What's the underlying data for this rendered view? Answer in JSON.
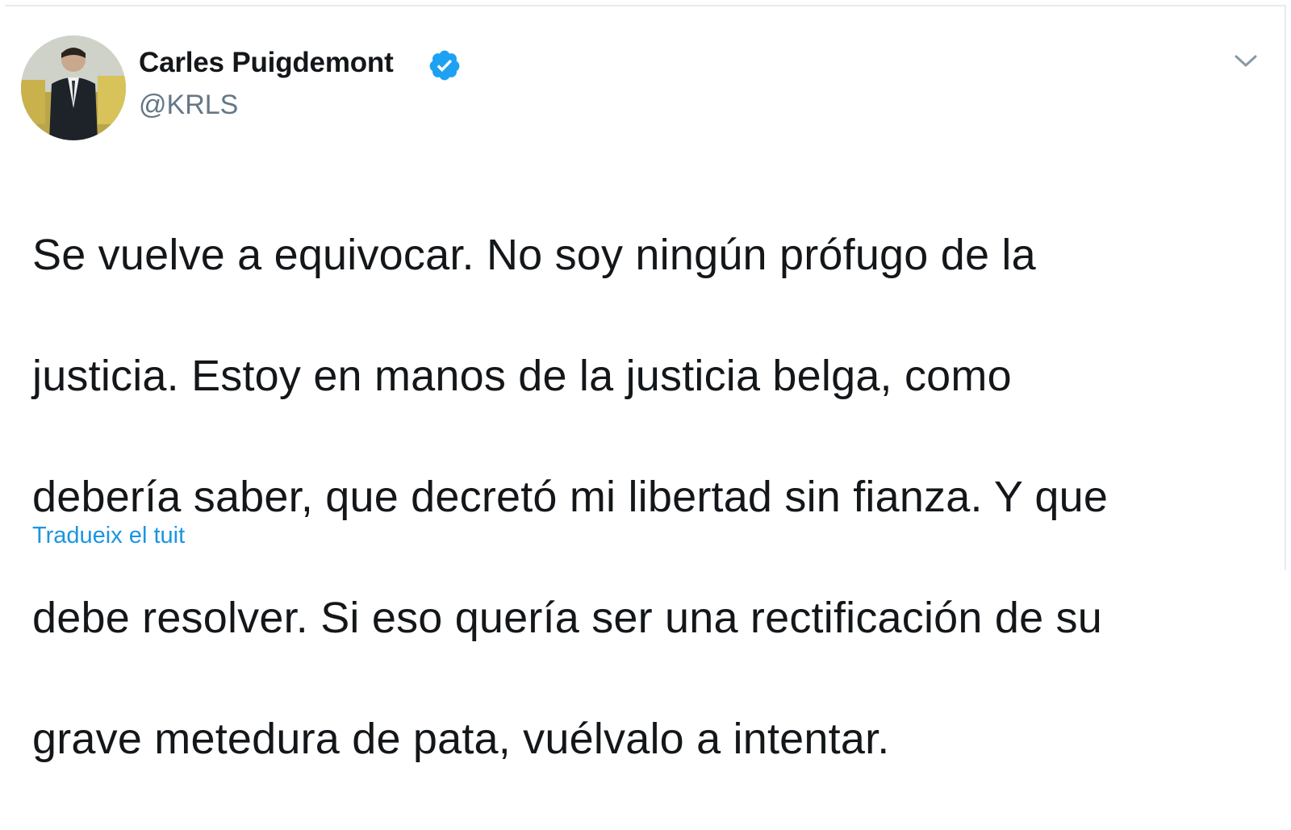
{
  "tweet": {
    "author_name": "Carles Puigdemont",
    "author_handle": "@KRLS",
    "text_lines": [
      "Se vuelve a equivocar. No soy ningún prófugo de la",
      "justicia. Estoy en manos de la justicia belga, como",
      "debería saber, que decretó mi libertad sin fianza. Y que",
      "debe resolver. Si eso quería ser una rectificación de su",
      "grave metedura de pata, vuélvalo a intentar."
    ],
    "translate_label": "Tradueix el tuit"
  },
  "icons": {
    "avatar": "avatar-photo",
    "verified": "verified-badge-icon",
    "menu": "chevron-down-icon"
  },
  "colors": {
    "name": "#14171a",
    "handle": "#657786",
    "body": "#14171a",
    "link": "#1b95e0",
    "verified": "#1da1f2",
    "border": "#e6ecf0"
  }
}
